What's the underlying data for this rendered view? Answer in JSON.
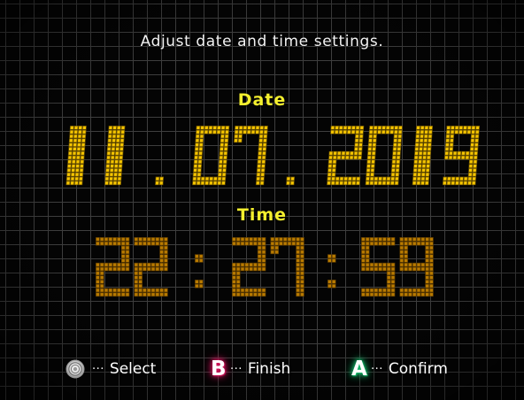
{
  "screen": {
    "instruction": "Adjust date and time settings."
  },
  "date": {
    "label": "Date",
    "day": "11",
    "month": "07",
    "year": "2019",
    "separator": ".",
    "text": "11.07.2019"
  },
  "time": {
    "label": "Time",
    "hours": "22",
    "minutes": "27",
    "seconds": "59",
    "separator": ":",
    "text": "22:27:59"
  },
  "footer": {
    "ellipsis": "···",
    "select": {
      "icon": "control-stick-icon",
      "label": "Select"
    },
    "finish": {
      "icon": "b-button-icon",
      "button": "B",
      "label": "Finish"
    },
    "confirm": {
      "icon": "a-button-icon",
      "button": "A",
      "label": "Confirm"
    }
  },
  "colors": {
    "date_digit_fill": "#f5c400",
    "date_digit_stroke": "#6b5200",
    "time_digit_fill": "#b87a00",
    "time_digit_stroke": "#5a3a00",
    "label": "#f4ef2e",
    "grid": "#3e3e3e",
    "background": "#040404",
    "b_button_glow": "#d2145a",
    "a_button_glow": "#17b96b"
  }
}
